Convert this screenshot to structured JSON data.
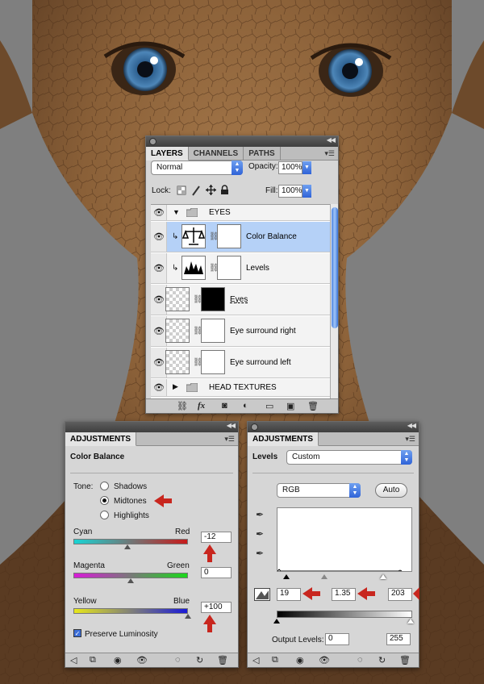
{
  "layers_panel": {
    "tabs": [
      "LAYERS",
      "CHANNELS",
      "PATHS"
    ],
    "blend_mode": "Normal",
    "opacity_label": "Opacity:",
    "opacity_value": "100%",
    "lock_label": "Lock:",
    "fill_label": "Fill:",
    "fill_value": "100%",
    "layers": [
      {
        "name": "EYES",
        "type": "group",
        "expanded": true
      },
      {
        "name": "Color Balance",
        "type": "adjustment",
        "selected": true
      },
      {
        "name": "Levels",
        "type": "adjustment"
      },
      {
        "name": "Eyes",
        "type": "layer"
      },
      {
        "name": "Eye surround right",
        "type": "layer"
      },
      {
        "name": "Eye surround left",
        "type": "layer"
      },
      {
        "name": "HEAD TEXTURES",
        "type": "group",
        "expanded": false
      }
    ]
  },
  "color_balance_panel": {
    "tab": "ADJUSTMENTS",
    "title": "Color Balance",
    "tone_label": "Tone:",
    "tones": [
      {
        "label": "Shadows",
        "selected": false
      },
      {
        "label": "Midtones",
        "selected": true
      },
      {
        "label": "Highlights",
        "selected": false
      }
    ],
    "sliders": [
      {
        "left": "Cyan",
        "right": "Red",
        "value": "-12",
        "fraction": 0.47
      },
      {
        "left": "Magenta",
        "right": "Green",
        "value": "0",
        "fraction": 0.5
      },
      {
        "left": "Yellow",
        "right": "Blue",
        "value": "+100",
        "fraction": 1.0
      }
    ],
    "preserve_luminosity": "Preserve Luminosity",
    "preserve_checked": true
  },
  "levels_panel": {
    "tab": "ADJUSTMENTS",
    "title": "Levels",
    "preset": "Custom",
    "channel": "RGB",
    "auto_label": "Auto",
    "input_black": "19",
    "input_gamma": "1.35",
    "input_white": "203",
    "output_label": "Output Levels:",
    "output_black": "0",
    "output_white": "255"
  },
  "colors": {
    "highlight_arrow": "#c8261e",
    "selection": "#b5d1f7"
  }
}
